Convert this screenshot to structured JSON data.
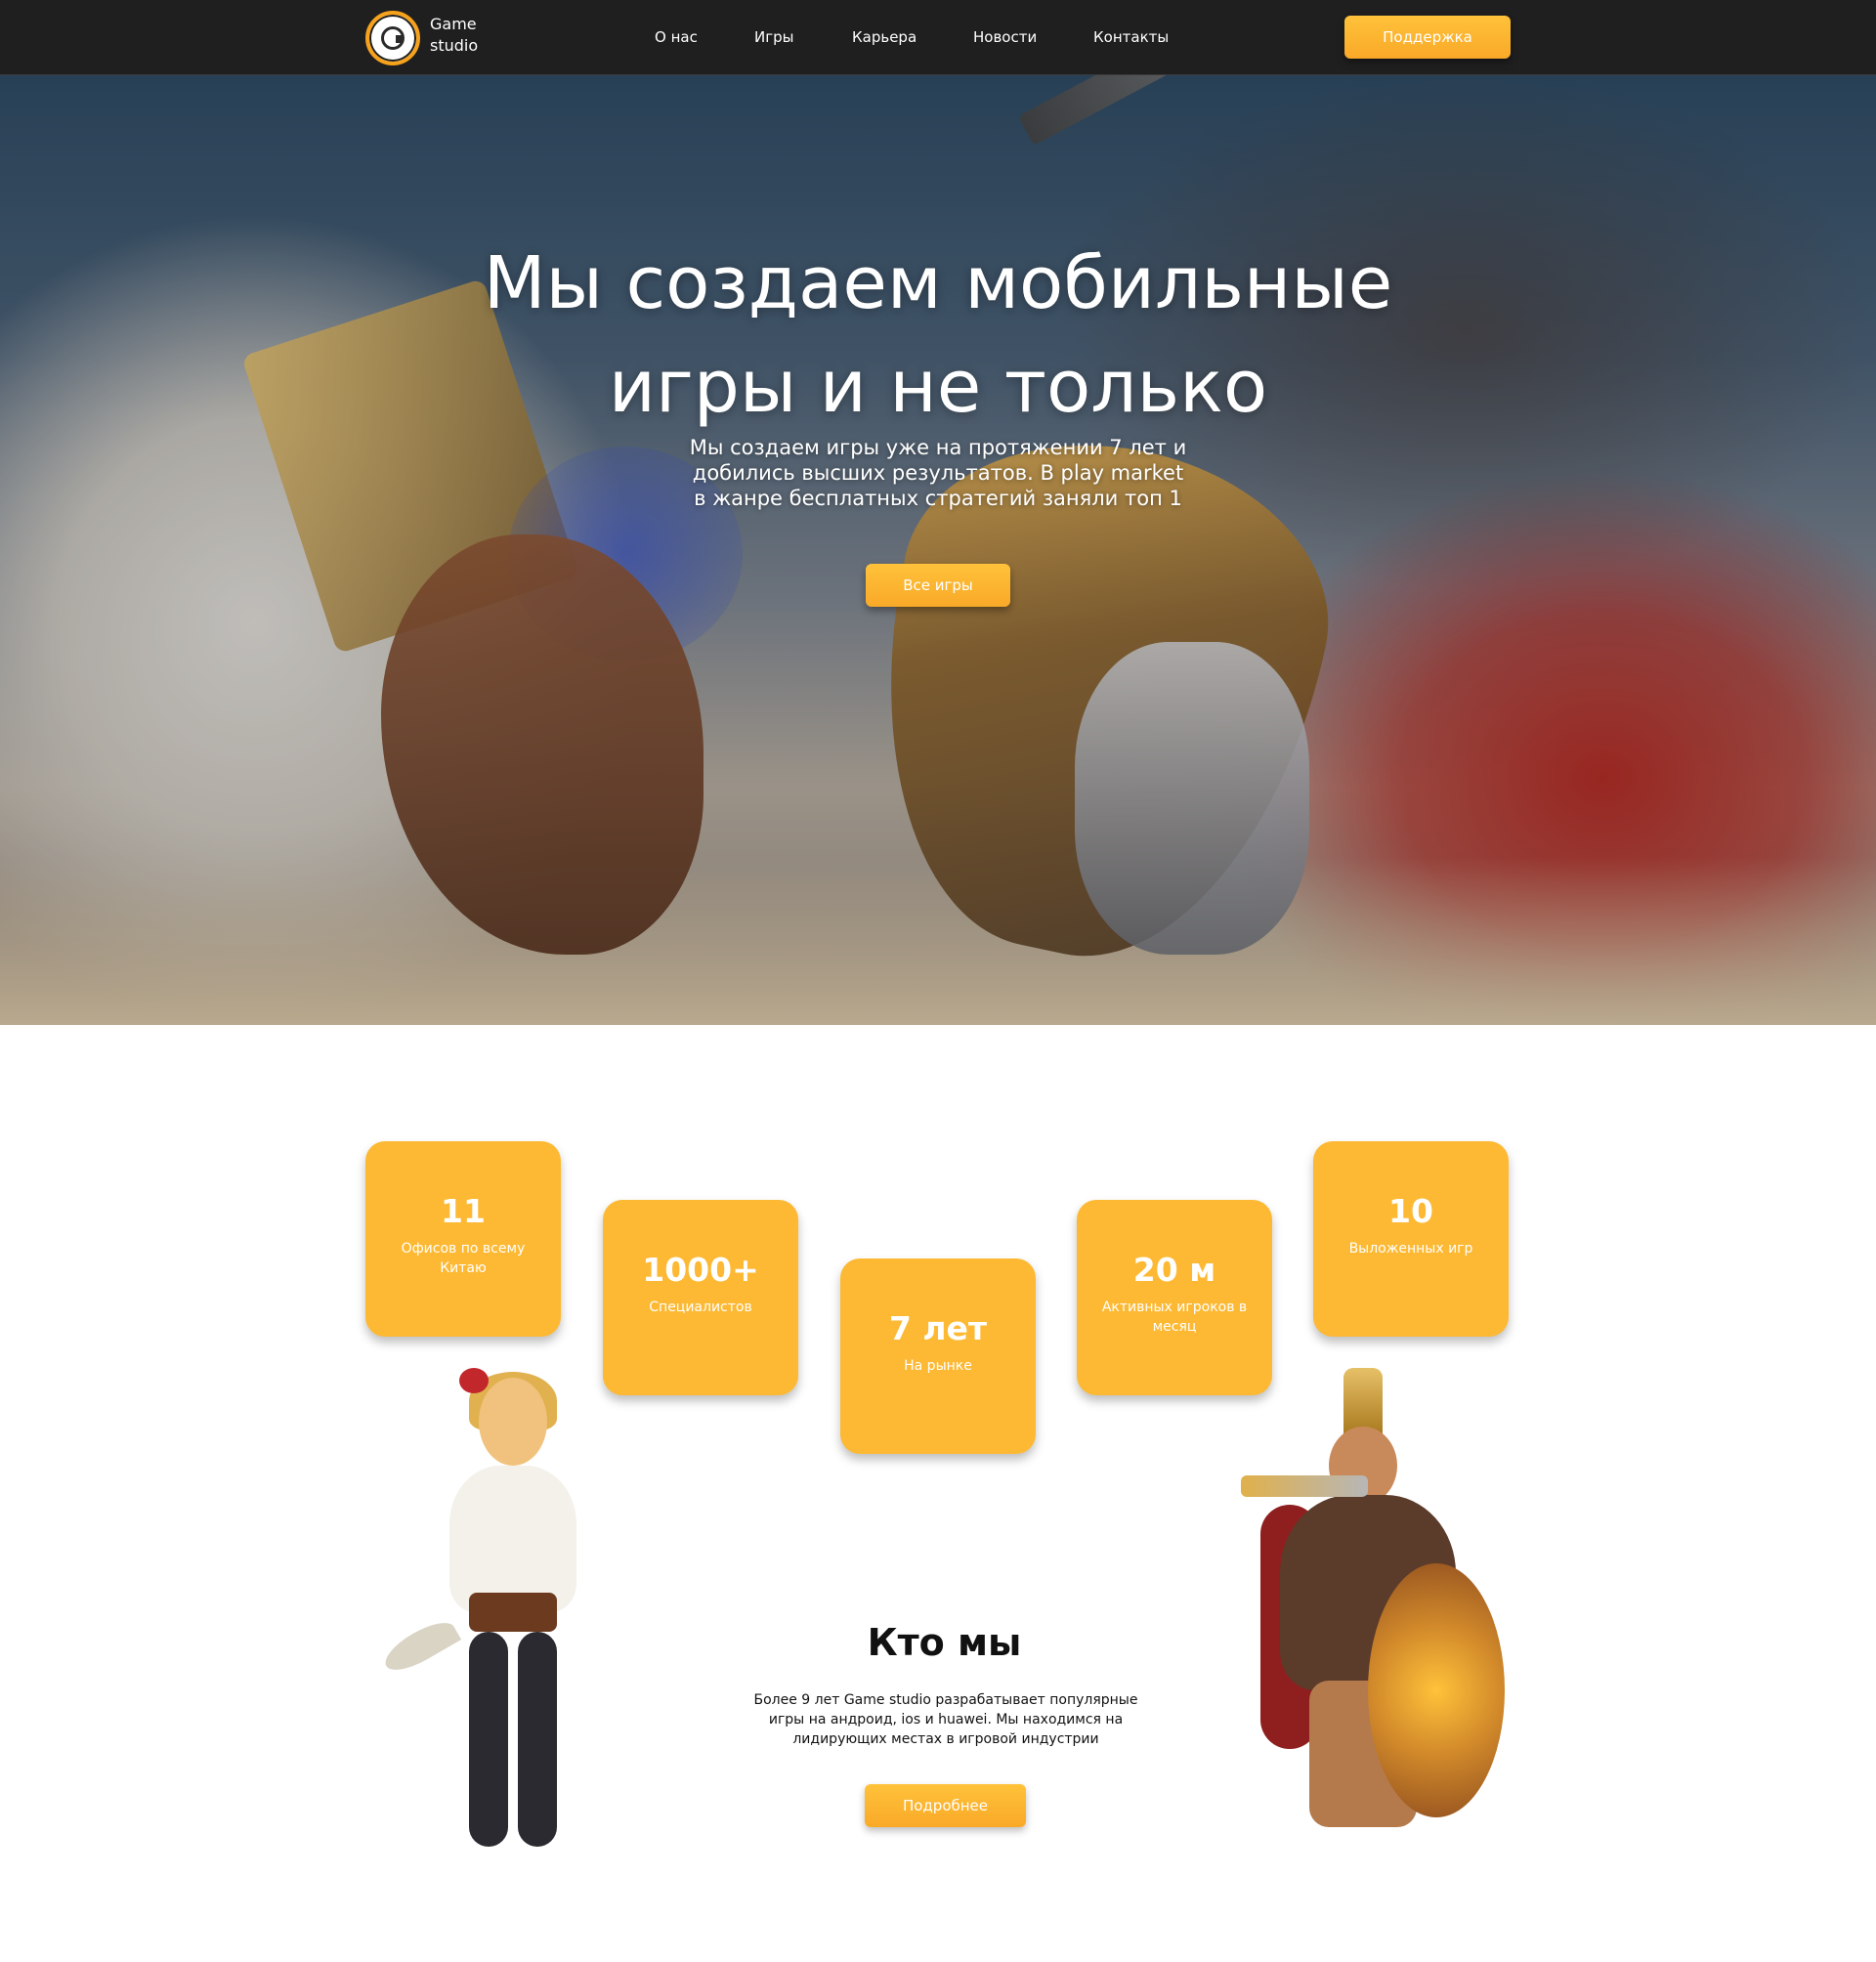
{
  "header": {
    "logo_text_line1": "Game",
    "logo_text_line2": "studio",
    "nav": [
      {
        "label": "О нас"
      },
      {
        "label": "Игры"
      },
      {
        "label": "Карьера"
      },
      {
        "label": "Новости"
      },
      {
        "label": "Контакты"
      }
    ],
    "support_label": "Поддержка"
  },
  "hero": {
    "title_line1": "Мы создаем мобильные",
    "title_line2": "игры и не только",
    "subtitle": "Мы создаем игры уже на протяжении 7 лет и добились высших результатов. В play market в жанре бесплатных стратегий заняли топ 1",
    "cta_label": "Все игры"
  },
  "stats": [
    {
      "value": "11",
      "label": "Офисов по всему Китаю"
    },
    {
      "value": "1000+",
      "label": "Специалистов"
    },
    {
      "value": "7 лет",
      "label": "На рынке"
    },
    {
      "value": "20 м",
      "label": "Активных игроков в месяц"
    },
    {
      "value": "10",
      "label": "Выложенных игр"
    }
  ],
  "about": {
    "title": "Кто мы",
    "text": "Более 9 лет Game studio разрабатывает популярные игры на андроид, ios и huawei. Мы находимся на лидирующих местах в игровой индустрии",
    "cta_label": "Подробнее"
  },
  "colors": {
    "accent": "#fdb933",
    "header_bg": "#1f1f1f"
  },
  "icons": {
    "logo": "game-studio-logo-icon"
  }
}
